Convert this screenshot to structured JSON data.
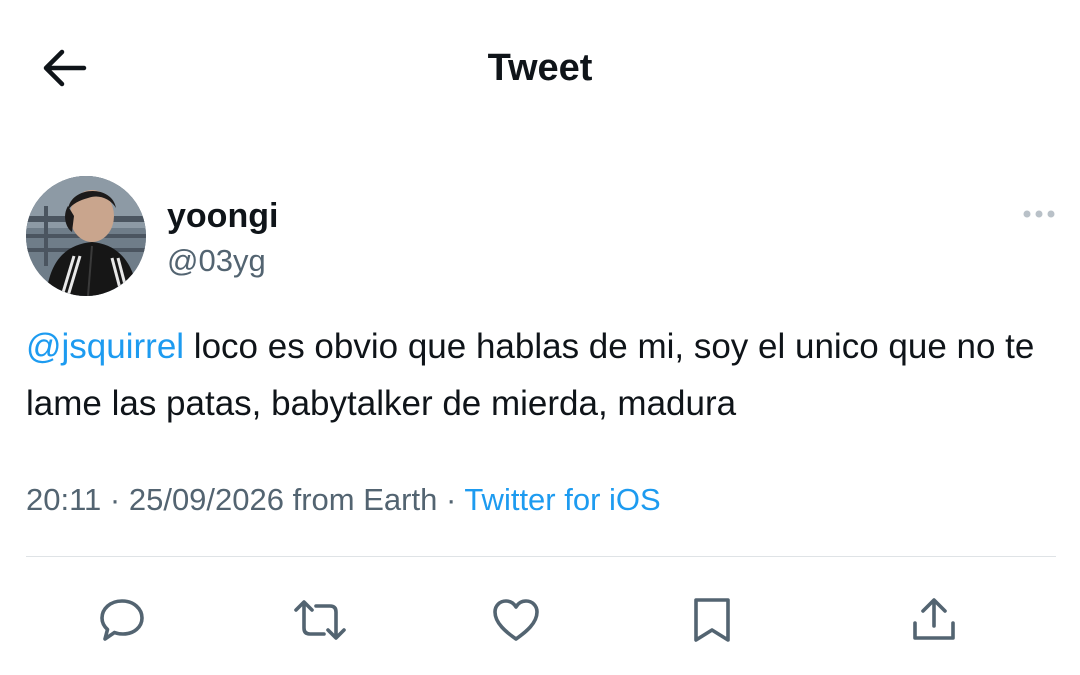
{
  "header": {
    "title": "Tweet",
    "back_icon": "arrow-left-icon"
  },
  "tweet": {
    "author": {
      "name": "yoongi",
      "handle": "@03yg",
      "avatar_icon": "profile-photo"
    },
    "text": {
      "mention": "@jsquirrel",
      "body": " loco es obvio que hablas de mi, soy el unico que no te lame las patas, babytalker de mierda, madura"
    },
    "meta": {
      "time": "20:11",
      "separator": " · ",
      "date": "25/09/2026",
      "location": " from Earth",
      "separator2": " · ",
      "source": "Twitter for iOS"
    },
    "actions": [
      {
        "name": "reply",
        "icon": "reply-icon"
      },
      {
        "name": "retweet",
        "icon": "retweet-icon"
      },
      {
        "name": "like",
        "icon": "heart-icon"
      },
      {
        "name": "bookmark",
        "icon": "bookmark-icon"
      },
      {
        "name": "share",
        "icon": "share-icon"
      }
    ]
  },
  "colors": {
    "accent": "#1d9bf0",
    "text_primary": "#0f1419",
    "text_secondary": "#536471",
    "divider": "#dfe3e6"
  }
}
